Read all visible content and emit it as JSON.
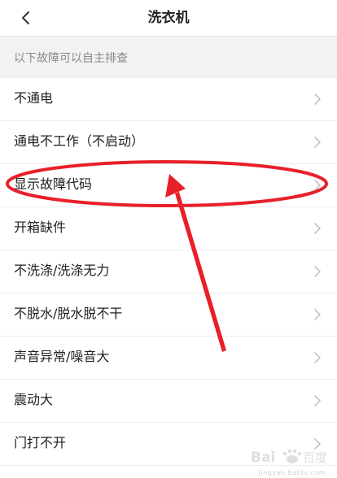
{
  "nav": {
    "title": "洗衣机"
  },
  "section": {
    "header": "以下故障可以自主排查"
  },
  "items": [
    {
      "label": "不通电"
    },
    {
      "label": "通电不工作（不启动）"
    },
    {
      "label": "显示故障代码"
    },
    {
      "label": "开箱缺件"
    },
    {
      "label": "不洗涤/洗涤无力"
    },
    {
      "label": "不脱水/脱水脱不干"
    },
    {
      "label": "声音异常/噪音大"
    },
    {
      "label": "震动大"
    },
    {
      "label": "门打不开"
    }
  ],
  "icons": {
    "back": "chevron-left-icon",
    "row_arrow": "chevron-right-icon"
  },
  "colors": {
    "annotation": "#e8202a",
    "chevron": "#c4c4c4",
    "section_bg": "#f2f2f2"
  },
  "watermark": {
    "logo": "Bai百度",
    "sub": "jingyan.baidu.com"
  }
}
